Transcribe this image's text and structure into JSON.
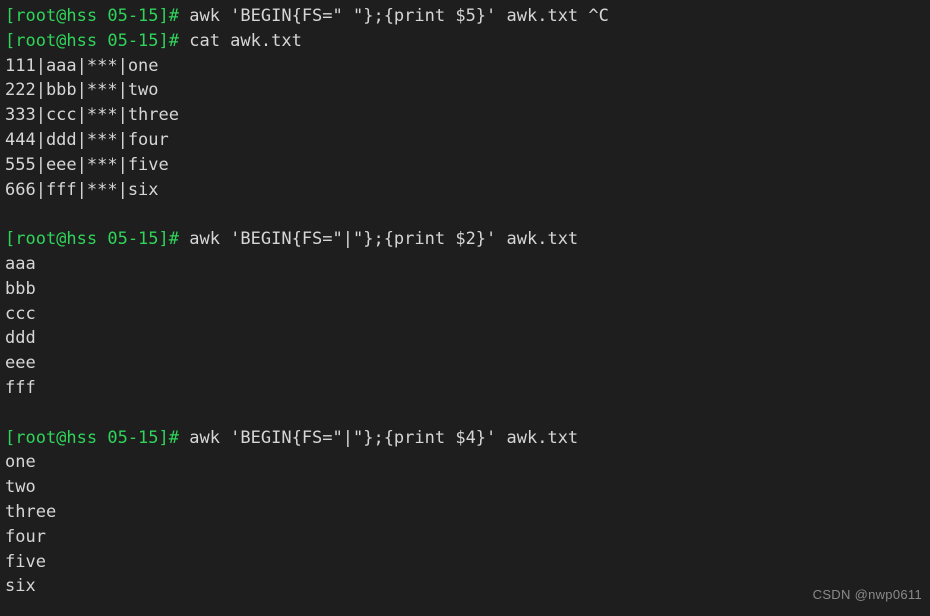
{
  "terminal": {
    "colors": {
      "background": "#1e1e1e",
      "prompt": "#2fd45a",
      "text": "#d6d6d6",
      "watermark": "#8a8a8a"
    },
    "prompt": "[root@hss 05-15]#",
    "lines": [
      {
        "type": "command",
        "prompt": "[root@hss 05-15]#",
        "command": " awk 'BEGIN{FS=\" \"};{print $5}' awk.txt ^C"
      },
      {
        "type": "command",
        "prompt": "[root@hss 05-15]#",
        "command": " cat awk.txt"
      },
      {
        "type": "output",
        "text": "111|aaa|***|one"
      },
      {
        "type": "output",
        "text": "222|bbb|***|two"
      },
      {
        "type": "output",
        "text": "333|ccc|***|three"
      },
      {
        "type": "output",
        "text": "444|ddd|***|four"
      },
      {
        "type": "output",
        "text": "555|eee|***|five"
      },
      {
        "type": "output",
        "text": "666|fff|***|six"
      },
      {
        "type": "blank",
        "text": ""
      },
      {
        "type": "command",
        "prompt": "[root@hss 05-15]#",
        "command": " awk 'BEGIN{FS=\"|\"};{print $2}' awk.txt"
      },
      {
        "type": "output",
        "text": "aaa"
      },
      {
        "type": "output",
        "text": "bbb"
      },
      {
        "type": "output",
        "text": "ccc"
      },
      {
        "type": "output",
        "text": "ddd"
      },
      {
        "type": "output",
        "text": "eee"
      },
      {
        "type": "output",
        "text": "fff"
      },
      {
        "type": "blank",
        "text": ""
      },
      {
        "type": "command",
        "prompt": "[root@hss 05-15]#",
        "command": " awk 'BEGIN{FS=\"|\"};{print $4}' awk.txt"
      },
      {
        "type": "output",
        "text": "one"
      },
      {
        "type": "output",
        "text": "two"
      },
      {
        "type": "output",
        "text": "three"
      },
      {
        "type": "output",
        "text": "four"
      },
      {
        "type": "output",
        "text": "five"
      },
      {
        "type": "output",
        "text": "six"
      }
    ]
  },
  "watermark": {
    "text": "CSDN @nwp0611"
  }
}
